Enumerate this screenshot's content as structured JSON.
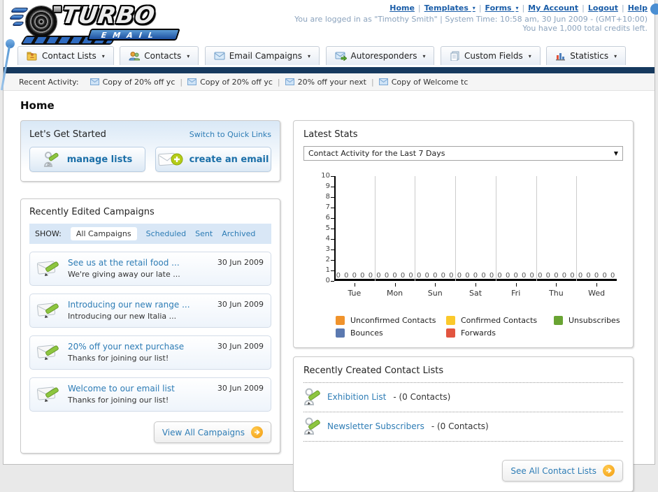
{
  "ui": {
    "separator": "|"
  },
  "header": {
    "logo": {
      "line1": "TURBO",
      "line2": "EMAIL"
    },
    "nav_links": [
      {
        "label": "Home",
        "dropdown": false
      },
      {
        "label": "Templates",
        "dropdown": true
      },
      {
        "label": "Forms",
        "dropdown": true
      },
      {
        "label": "My Account",
        "dropdown": false
      },
      {
        "label": "Logout",
        "dropdown": false
      },
      {
        "label": "Help",
        "dropdown": false
      }
    ],
    "login_line": "You are logged in as \"Timothy Smith\" | System Time: 10:58 am, 30 Jun 2009 - (GMT+10:00)",
    "credits_line": "You have 1,000 total credits left."
  },
  "nav_tabs": [
    {
      "label": "Contact Lists"
    },
    {
      "label": "Contacts"
    },
    {
      "label": "Email Campaigns"
    },
    {
      "label": "Autoresponders"
    },
    {
      "label": "Custom Fields"
    },
    {
      "label": "Statistics"
    }
  ],
  "recent_activity": {
    "label": "Recent Activity:",
    "items": [
      "Copy of 20% off yc",
      "Copy of 20% off yc",
      "20% off your next",
      "Copy of Welcome tc"
    ]
  },
  "page_title": "Home",
  "get_started": {
    "title": "Let's Get Started",
    "switch_link": "Switch to Quick Links",
    "buttons": [
      {
        "label": "manage lists"
      },
      {
        "label": "create an email"
      }
    ]
  },
  "campaigns": {
    "title": "Recently Edited Campaigns",
    "show_label": "SHOW:",
    "filters": [
      "All Campaigns",
      "Scheduled",
      "Sent",
      "Archived"
    ],
    "active_filter": "All Campaigns",
    "items": [
      {
        "title": "See us at the retail food ...",
        "subtitle": "We're giving away our late ...",
        "date": "30 Jun 2009"
      },
      {
        "title": "Introducing our new range ...",
        "subtitle": "Introducing our new Italia ...",
        "date": "30 Jun 2009"
      },
      {
        "title": "20% off your next purchase",
        "subtitle": "Thanks for joining our list!",
        "date": "30 Jun 2009"
      },
      {
        "title": "Welcome to our email list",
        "subtitle": "Thanks for joining our list!",
        "date": "30 Jun 2009"
      }
    ],
    "view_all_label": "View All Campaigns"
  },
  "stats": {
    "title": "Latest Stats",
    "dropdown_value": "Contact Activity for the Last 7 Days"
  },
  "chart_data": {
    "type": "bar",
    "title": "Contact Activity for the Last 7 Days",
    "categories": [
      "Tue",
      "Mon",
      "Sun",
      "Sat",
      "Fri",
      "Thu",
      "Wed"
    ],
    "series": [
      {
        "name": "Unconfirmed Contacts",
        "color": "#f0932c",
        "values": [
          0,
          0,
          0,
          0,
          0,
          0,
          0
        ]
      },
      {
        "name": "Confirmed Contacts",
        "color": "#fbc92b",
        "values": [
          0,
          0,
          0,
          0,
          0,
          0,
          0
        ]
      },
      {
        "name": "Unsubscribes",
        "color": "#69a433",
        "values": [
          0,
          0,
          0,
          0,
          0,
          0,
          0
        ]
      },
      {
        "name": "Bounces",
        "color": "#5b79b0",
        "values": [
          0,
          0,
          0,
          0,
          0,
          0,
          0
        ]
      },
      {
        "name": "Forwards",
        "color": "#e25540",
        "values": [
          0,
          0,
          0,
          0,
          0,
          0,
          0
        ]
      }
    ],
    "ylim": [
      0,
      10
    ],
    "yticks": [
      0,
      1,
      2,
      3,
      4,
      5,
      6,
      7,
      8,
      9,
      10
    ],
    "grid": "vertical group separators only",
    "legend_position": "bottom",
    "value_labels_shown": true
  },
  "contact_lists": {
    "title": "Recently Created Contact Lists",
    "items": [
      {
        "name": "Exhibition List",
        "detail": "- (0 Contacts)"
      },
      {
        "name": "Newsletter Subscribers",
        "detail": "- (0 Contacts)"
      }
    ],
    "see_all_label": "See All Contact Lists"
  },
  "colors": {
    "navy_bar": "#16395e",
    "link_blue": "#2d7cb5",
    "header_link_blue": "#1a5da8",
    "muted_login_text": "#8ba3bd",
    "orange_arrow": "#f29c11"
  }
}
